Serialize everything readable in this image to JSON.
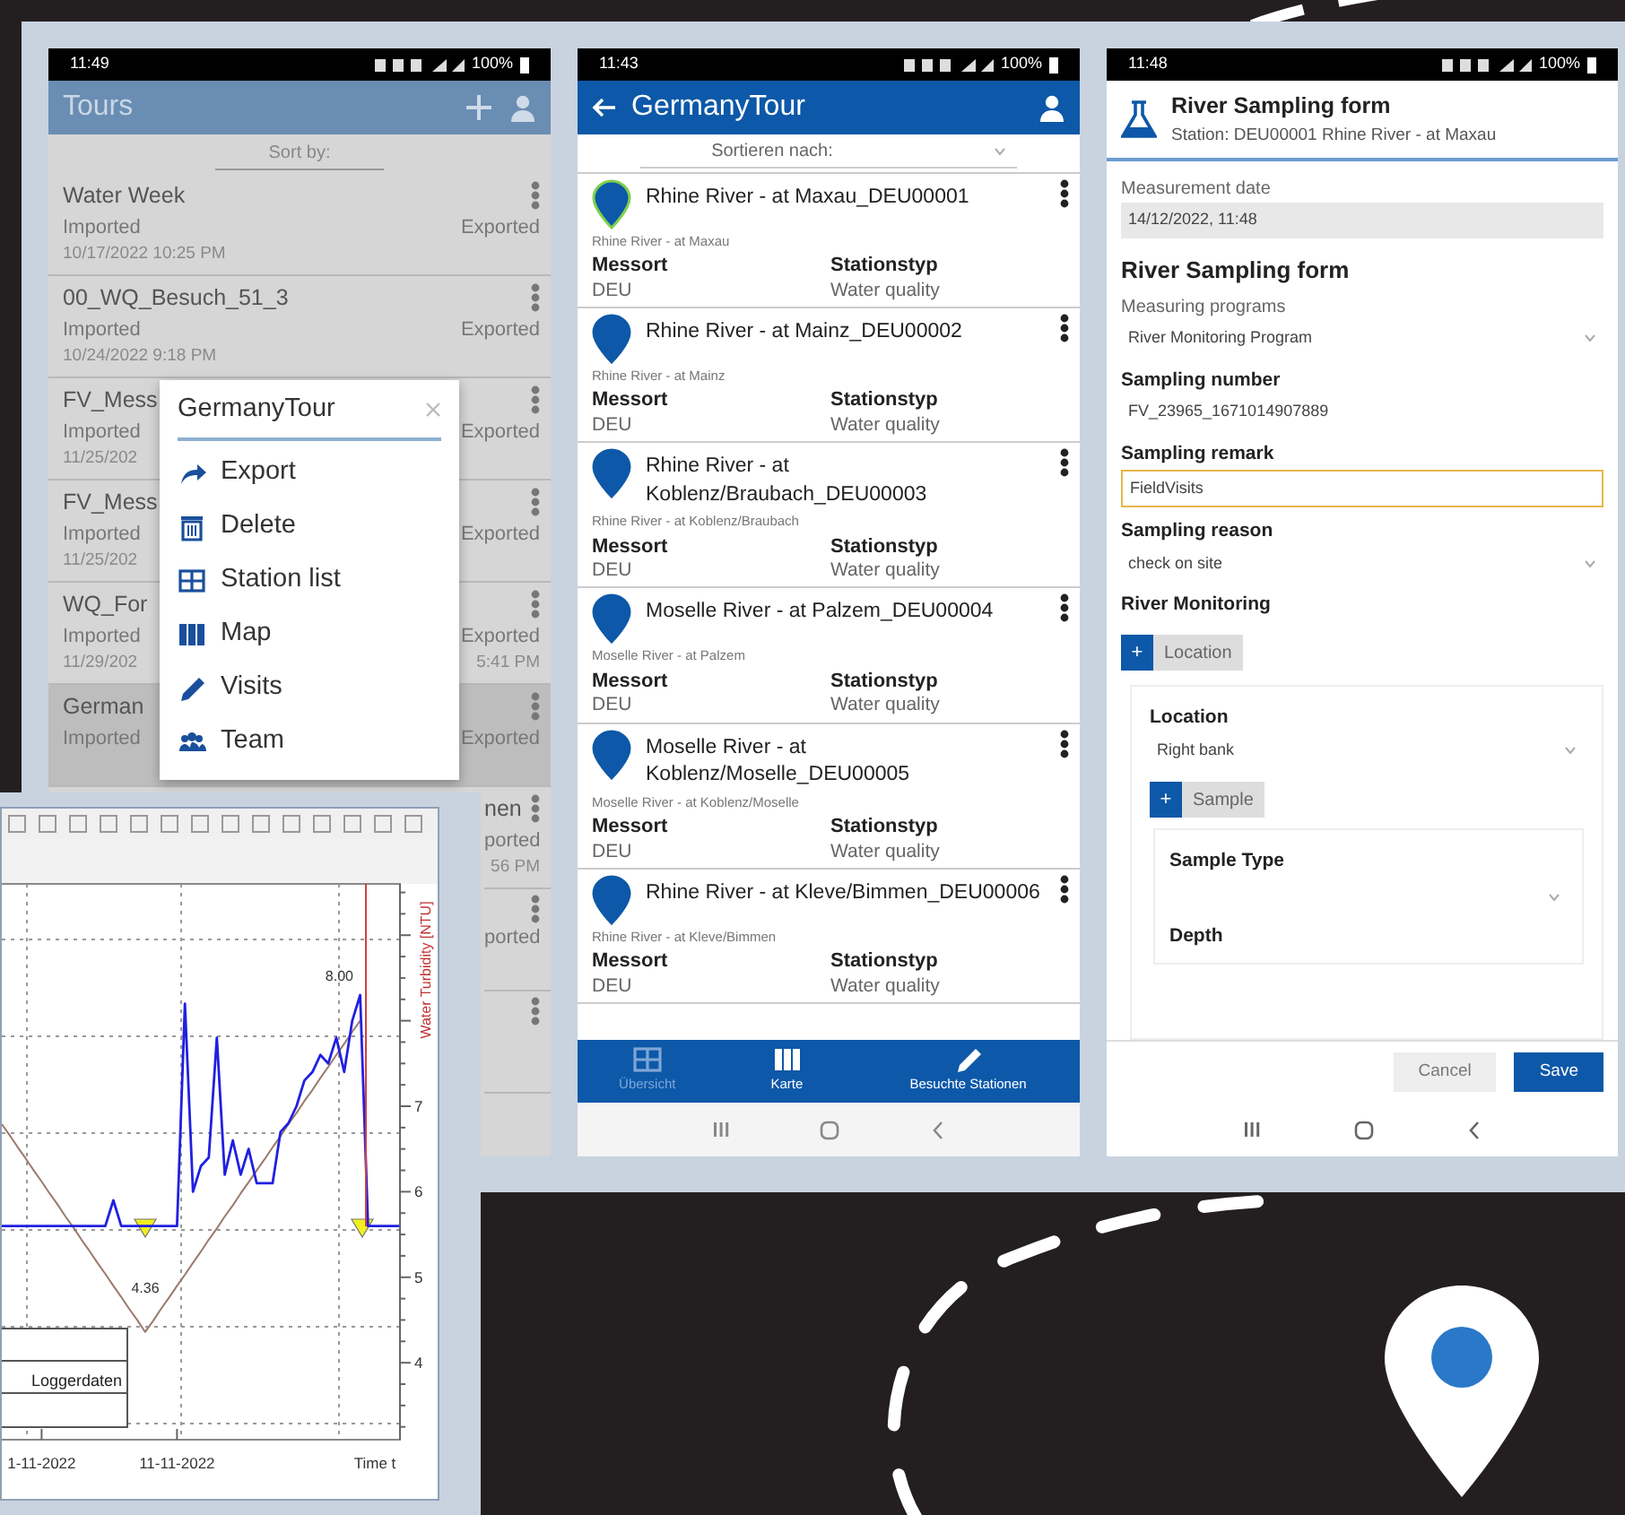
{
  "tours_screen": {
    "status_time": "11:49",
    "status_battery": "100%",
    "title": "Tours",
    "sort_label": "Sort by:",
    "rows": [
      {
        "kind": "full",
        "title": "Water Week",
        "left_status": "Imported",
        "right_status": "Exported",
        "date": "10/17/2022 10:25 PM",
        "selected": false
      },
      {
        "kind": "full",
        "title": "00_WQ_Besuch_51_3",
        "left_status": "Imported",
        "right_status": "Exported",
        "date": "10/24/2022 9:18 PM",
        "selected": false
      },
      {
        "kind": "full",
        "title": "FV_Mess",
        "left_status": "Imported",
        "right_status": "Exported",
        "date": "11/25/202",
        "selected": false
      },
      {
        "kind": "full",
        "title": "FV_Mess",
        "left_status": "Imported",
        "right_status": "Exported",
        "date": "11/25/202",
        "selected": false
      },
      {
        "kind": "full",
        "title": "WQ_For",
        "left_status": "Imported",
        "right_status": "Exported",
        "date": "11/29/202",
        "date_right": "5:41 PM",
        "selected": false
      },
      {
        "kind": "full",
        "title": "German",
        "left_status": "Imported",
        "right_status": "Exported",
        "selected": true
      },
      {
        "kind": "clipped",
        "title": "nen",
        "right_status": "ported",
        "date_right": "56 PM",
        "selected": false
      },
      {
        "kind": "clipped",
        "right_status": "ported",
        "selected": false
      },
      {
        "kind": "clipped",
        "selected": false
      }
    ],
    "menu": {
      "title": "GermanyTour",
      "items": [
        {
          "kind": "export",
          "label": "Export"
        },
        {
          "kind": "delete",
          "label": "Delete"
        },
        {
          "kind": "list",
          "label": "Station list"
        },
        {
          "kind": "map",
          "label": "Map"
        },
        {
          "kind": "visits",
          "label": "Visits"
        },
        {
          "kind": "team",
          "label": "Team"
        }
      ]
    }
  },
  "logger_window": {
    "chart_data": {
      "type": "line",
      "xlabel": "Time t",
      "ylabel": "Water Turbidity [NTU]",
      "categories": [
        null,
        null,
        null,
        null,
        null,
        "1-11-2022",
        null,
        null,
        null,
        null,
        null,
        null,
        null,
        null,
        null,
        null,
        null,
        null,
        null,
        null,
        null,
        null,
        "11-11-2022",
        null,
        null,
        null,
        null,
        null,
        null,
        null,
        null,
        null,
        null,
        null,
        null,
        null,
        null,
        null,
        null,
        null,
        null,
        null,
        null,
        null,
        null,
        null,
        null,
        null,
        null,
        null,
        null
      ],
      "series": [
        {
          "name": "Loggerdaten",
          "color": "#2020e0",
          "values": [
            5.6,
            5.6,
            5.6,
            5.6,
            5.6,
            5.6,
            5.6,
            5.6,
            5.6,
            5.6,
            5.6,
            5.6,
            5.6,
            5.6,
            5.9,
            5.6,
            5.6,
            5.6,
            5.6,
            5.6,
            5.6,
            5.6,
            5.6,
            8.2,
            6.0,
            6.3,
            6.4,
            7.8,
            6.2,
            6.6,
            6.2,
            6.5,
            6.1,
            6.1,
            6.1,
            6.7,
            6.8,
            7.0,
            7.3,
            7.4,
            7.6,
            7.5,
            7.8,
            7.4,
            8.0,
            8.3,
            5.6,
            5.6,
            5.6,
            5.6,
            5.6
          ]
        },
        {
          "color": "#9a7a6a",
          "values": [
            6.79,
            6.66,
            6.52,
            6.39,
            6.25,
            6.12,
            5.98,
            5.85,
            5.71,
            5.58,
            5.44,
            5.31,
            5.17,
            5.04,
            4.9,
            4.77,
            4.63,
            4.5,
            4.36,
            4.49,
            4.63,
            4.76,
            4.9,
            5.03,
            5.17,
            5.3,
            5.44,
            5.57,
            5.71,
            5.84,
            5.98,
            6.11,
            6.25,
            6.38,
            6.52,
            6.65,
            6.79,
            6.92,
            7.06,
            7.19,
            7.33,
            7.46,
            7.6,
            7.73,
            7.87,
            8.0,
            null,
            null,
            null,
            null,
            null
          ]
        }
      ],
      "ylim": [
        3.1,
        9.6
      ],
      "yticks": [
        4,
        5,
        6,
        7
      ],
      "annotations": [
        "4.36",
        "8.00"
      ]
    }
  },
  "stations_screen": {
    "status_time": "11:43",
    "status_battery": "100%",
    "title": "GermanyTour",
    "sort_label": "Sortieren nach:",
    "stations": [
      {
        "title": "Rhine River - at Maxau_DEU00001",
        "subtitle": "Rhine River - at Maxau",
        "location_label": "Messort",
        "location": "DEU",
        "type_label": "Stationstyp",
        "type": "Water quality",
        "selected": true
      },
      {
        "title": "Rhine River - at Mainz_DEU00002",
        "subtitle": "Rhine River - at Mainz",
        "location_label": "Messort",
        "location": "DEU",
        "type_label": "Stationstyp",
        "type": "Water quality",
        "selected": false
      },
      {
        "title": "Rhine River - at Koblenz/Braubach_DEU00003",
        "subtitle": "Rhine River - at Koblenz/Braubach",
        "location_label": "Messort",
        "location": "DEU",
        "type_label": "Stationstyp",
        "type": "Water quality",
        "selected": false
      },
      {
        "title": "Moselle River - at Palzem_DEU00004",
        "subtitle": "Moselle River - at Palzem",
        "location_label": "Messort",
        "location": "DEU",
        "type_label": "Stationstyp",
        "type": "Water quality",
        "selected": false
      },
      {
        "title": "Moselle River - at Koblenz/Moselle_DEU00005",
        "subtitle": "Moselle River - at Koblenz/Moselle",
        "location_label": "Messort",
        "location": "DEU",
        "type_label": "Stationstyp",
        "type": "Water quality",
        "selected": false
      },
      {
        "title": "Rhine River - at Kleve/Bimmen_DEU00006",
        "subtitle": "Rhine River - at Kleve/Bimmen",
        "location_label": "Messort",
        "location": "DEU",
        "type_label": "Stationstyp",
        "type": "Water quality",
        "selected": false
      }
    ],
    "nav": [
      {
        "kind": "grid",
        "label": "Übersicht",
        "selected": true
      },
      {
        "kind": "map",
        "label": "Karte",
        "selected": false
      },
      {
        "kind": "pencil",
        "label": "Besuchte Stationen",
        "selected": false
      }
    ]
  },
  "form_screen": {
    "status_time": "11:48",
    "status_battery": "100%",
    "title": "River Sampling form",
    "subtitle": "Station: DEU00001 Rhine River - at Maxau",
    "fields": [
      {
        "kind": "date",
        "label": "Measurement date",
        "value": "14/12/2022, 11:48"
      },
      {
        "kind": "heading",
        "label": "River Sampling form"
      },
      {
        "kind": "select",
        "label": "Measuring programs",
        "value": "River Monitoring Program"
      },
      {
        "kind": "text",
        "label": "Sampling number",
        "value": "FV_23965_1671014907889"
      },
      {
        "kind": "input",
        "label": "Sampling remark",
        "value": "FieldVisits",
        "focused": true
      },
      {
        "kind": "select",
        "label": "Sampling reason",
        "value": "check on site"
      },
      {
        "kind": "section",
        "label": "River Monitoring"
      }
    ],
    "add_location": {
      "glyph": "+",
      "label": "Location"
    },
    "location_card": {
      "label": "Location",
      "value": "Right bank",
      "add_sample": {
        "glyph": "+",
        "label": "Sample"
      },
      "sample_card": {
        "type_label": "Sample Type",
        "depth_label": "Depth"
      }
    },
    "buttons": [
      {
        "kind": "secondary",
        "label": "Cancel"
      },
      {
        "kind": "primary",
        "label": "Save"
      }
    ]
  }
}
